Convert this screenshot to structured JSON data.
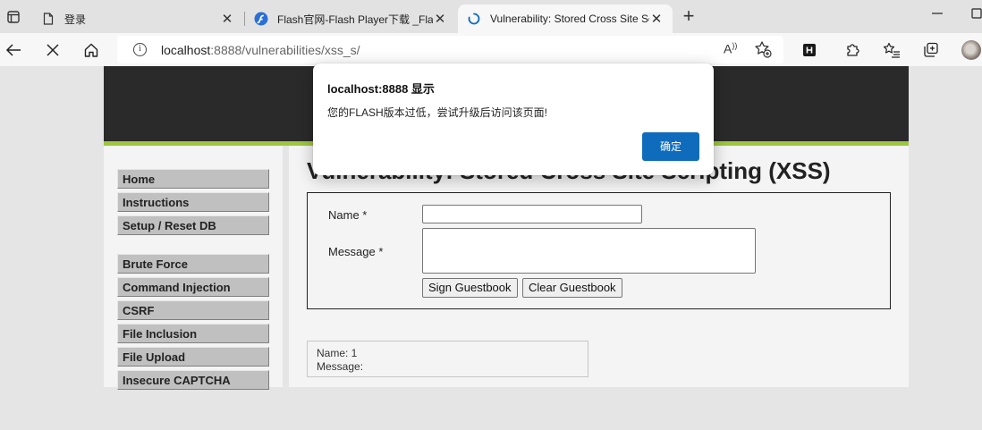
{
  "browser": {
    "tabs": [
      {
        "title": "登录",
        "favicon": "document-icon",
        "active": false
      },
      {
        "title": "Flash官网-Flash Player下载 _Flash",
        "favicon": "flash-icon",
        "active": false
      },
      {
        "title": "Vulnerability: Stored Cross Site Sc",
        "favicon": "loading-spinner-icon",
        "active": true
      }
    ],
    "new_tab_label": "+",
    "url": {
      "host": "localhost",
      "rest": ":8888/vulnerabilities/xss_s/"
    },
    "read_aloud_label": "A",
    "colors": {
      "accent": "#0f6cbd",
      "tab_strip": "#e2e2e2",
      "toolbar": "#f7f7f7"
    }
  },
  "site": {
    "colors": {
      "header": "#2a2a2a",
      "stripe": "#9dc63e",
      "menu": "#c0c0c0"
    },
    "menu_group1": [
      "Home",
      "Instructions",
      "Setup / Reset DB"
    ],
    "menu_group2": [
      "Brute Force",
      "Command Injection",
      "CSRF",
      "File Inclusion",
      "File Upload",
      "Insecure CAPTCHA"
    ],
    "heading": "Vulnerability: Stored Cross Site Scripting (XSS)",
    "form": {
      "name_label": "Name *",
      "name_value": "",
      "message_label": "Message *",
      "message_value": "",
      "sign_button": "Sign Guestbook",
      "clear_button": "Clear Guestbook"
    },
    "entry": {
      "name_line": "Name: 1",
      "message_line": "Message:"
    }
  },
  "dialog": {
    "title": "localhost:8888 显示",
    "message": "您的FLASH版本过低，尝试升级后访问该页面!",
    "ok_label": "确定"
  }
}
